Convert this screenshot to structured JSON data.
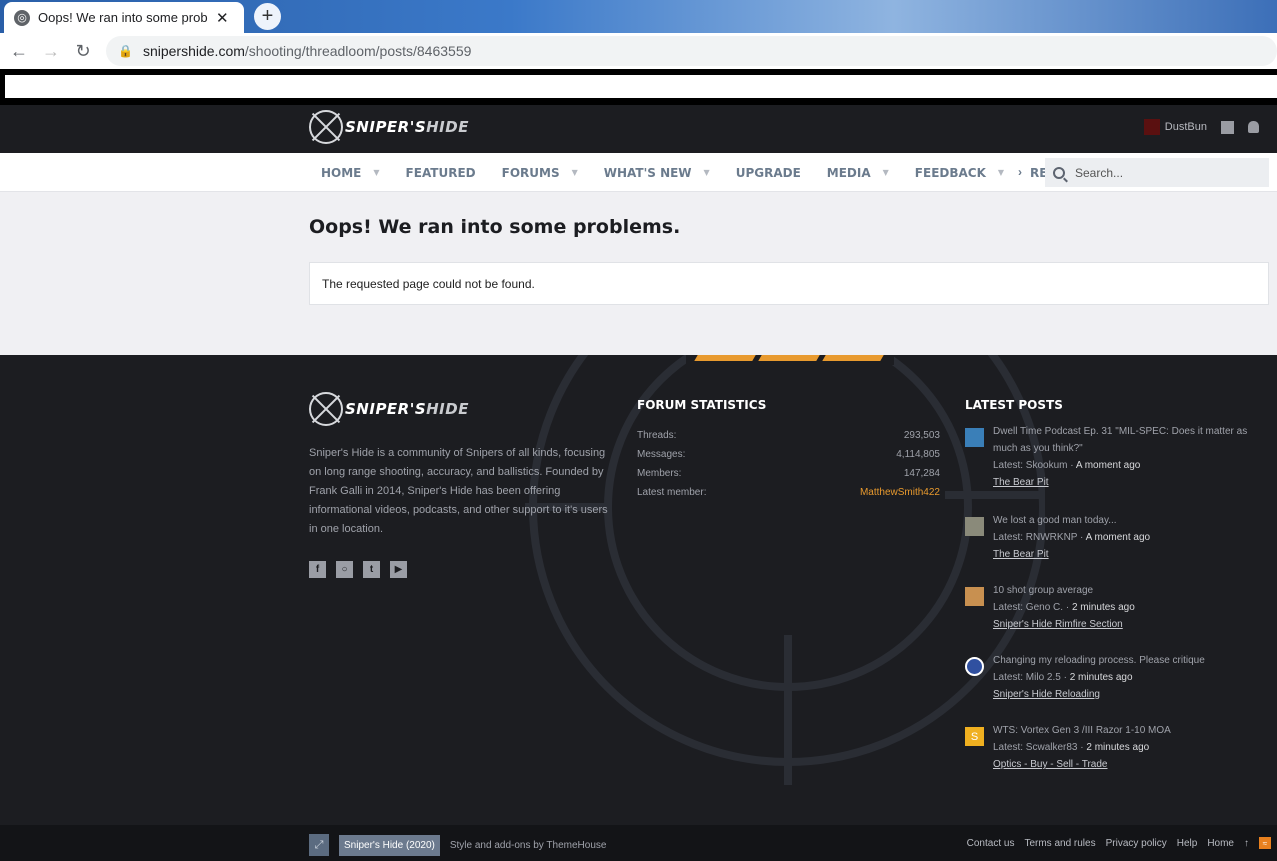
{
  "browser": {
    "tab_title": "Oops! We ran into some problems.",
    "url_domain": "snipershide.com",
    "url_path": "/shooting/threadloom/posts/8463559"
  },
  "header": {
    "logo_text_main": "SNIPER'S",
    "logo_text_hide": "HIDE",
    "username": "DustBun"
  },
  "nav": {
    "items": [
      {
        "label": "HOME",
        "caret": true
      },
      {
        "label": "FEATURED",
        "caret": false
      },
      {
        "label": "FORUMS",
        "caret": true
      },
      {
        "label": "WHAT'S NEW",
        "caret": true
      },
      {
        "label": "UPGRADE",
        "caret": false
      },
      {
        "label": "MEDIA",
        "caret": true
      },
      {
        "label": "FEEDBACK",
        "caret": true
      },
      {
        "label": "RESOURCES",
        "caret": true
      }
    ],
    "search_placeholder": "Search..."
  },
  "main": {
    "title": "Oops! We ran into some problems.",
    "message": "The requested page could not be found."
  },
  "footer": {
    "about": "Sniper's Hide is a community of Snipers of all kinds, focusing on long range shooting, accuracy, and ballistics. Founded by Frank Galli in 2014, Sniper's Hide has been offering informational videos, podcasts, and other support to it's users in one location.",
    "social": [
      "facebook-icon",
      "instagram-icon",
      "twitter-icon",
      "youtube-icon"
    ],
    "stats_heading": "FORUM STATISTICS",
    "stats": [
      {
        "label": "Threads:",
        "value": "293,503"
      },
      {
        "label": "Messages:",
        "value": "4,114,805"
      },
      {
        "label": "Members:",
        "value": "147,284"
      },
      {
        "label": "Latest member:",
        "value": "MatthewSmith422"
      }
    ],
    "latest_heading": "LATEST POSTS",
    "posts": [
      {
        "title": "Dwell Time Podcast Ep. 31 \"MIL-SPEC: Does it matter as much as you think?\"",
        "latest_prefix": "Latest: Skookum · ",
        "time": "A moment ago",
        "forum": "The Bear Pit",
        "avatar_color": "#3a7fb8"
      },
      {
        "title": "We lost a good man today...",
        "latest_prefix": "Latest: RNWRKNP · ",
        "time": "A moment ago",
        "forum": "The Bear Pit",
        "avatar_color": "#8a8a7a"
      },
      {
        "title": "10 shot group average",
        "latest_prefix": "Latest: Geno C. · ",
        "time": "2 minutes ago",
        "forum": "Sniper's Hide Rimfire Section",
        "avatar_color": "#c89050"
      },
      {
        "title": "Changing my reloading process. Please critique",
        "latest_prefix": "Latest: Milo 2.5 · ",
        "time": "2 minutes ago",
        "forum": "Sniper's Hide Reloading",
        "avatar_color": "#3050a0"
      },
      {
        "title": "WTS: Vortex Gen 3 /III Razor 1-10 MOA",
        "latest_prefix": "Latest: Scwalker83 · ",
        "time": "2 minutes ago",
        "forum": "Optics - Buy - Sell - Trade",
        "avatar_color": "#f0b020",
        "avatar_letter": "S"
      }
    ]
  },
  "footbar": {
    "style_label": "Sniper's Hide (2020)",
    "credit": "Style and add-ons by ThemeHouse",
    "links": [
      "Contact us",
      "Terms and rules",
      "Privacy policy",
      "Help",
      "Home"
    ]
  }
}
